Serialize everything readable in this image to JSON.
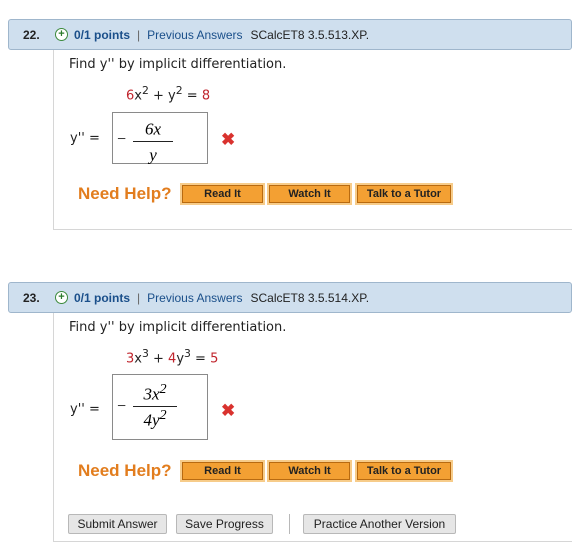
{
  "questions": [
    {
      "number": "22.",
      "points_icon": "plus-circle-icon",
      "points": "0/1 points",
      "separator": "|",
      "previous_answers": "Previous Answers",
      "code": "SCalcET8 3.5.513.XP.",
      "prompt": "Find y'' by implicit differentiation.",
      "equation": {
        "coef1": "6",
        "var1": "x",
        "exp1": "2",
        "op": " + ",
        "var2": "y",
        "exp2": "2",
        "eq": " = ",
        "rhs": "8"
      },
      "answer_label": "y'' =",
      "answer": {
        "sign": "−",
        "numerator": "6x",
        "numerator_exp": "",
        "denominator": "y",
        "denominator_exp": ""
      },
      "result_icon": "wrong-x-icon",
      "need_help": "Need Help?",
      "buttons": [
        "Read It",
        "Watch It",
        "Talk to a Tutor"
      ]
    },
    {
      "number": "23.",
      "points_icon": "plus-circle-icon",
      "points": "0/1 points",
      "separator": "|",
      "previous_answers": "Previous Answers",
      "code": "SCalcET8 3.5.514.XP.",
      "prompt": "Find y'' by implicit differentiation.",
      "equation": {
        "coef1": "3",
        "var1": "x",
        "exp1": "3",
        "op": " + ",
        "coef2": "4",
        "var2": "y",
        "exp2": "3",
        "eq": " = ",
        "rhs": "5"
      },
      "answer_label": "y'' =",
      "answer": {
        "sign": "−",
        "numerator": "3x",
        "numerator_exp": "2",
        "denominator": "4y",
        "denominator_exp": "2"
      },
      "result_icon": "wrong-x-icon",
      "need_help": "Need Help?",
      "buttons": [
        "Read It",
        "Watch It",
        "Talk to a Tutor"
      ]
    }
  ],
  "controls": [
    "Submit Answer",
    "Save Progress",
    "Practice Another Version"
  ],
  "colors": {
    "header_bg": "#cfdfee",
    "link": "#1a4f8a",
    "help": "#e27d1e",
    "button": "#f3a033",
    "wrong": "#d9322e",
    "equation_number": "#c0242c"
  }
}
